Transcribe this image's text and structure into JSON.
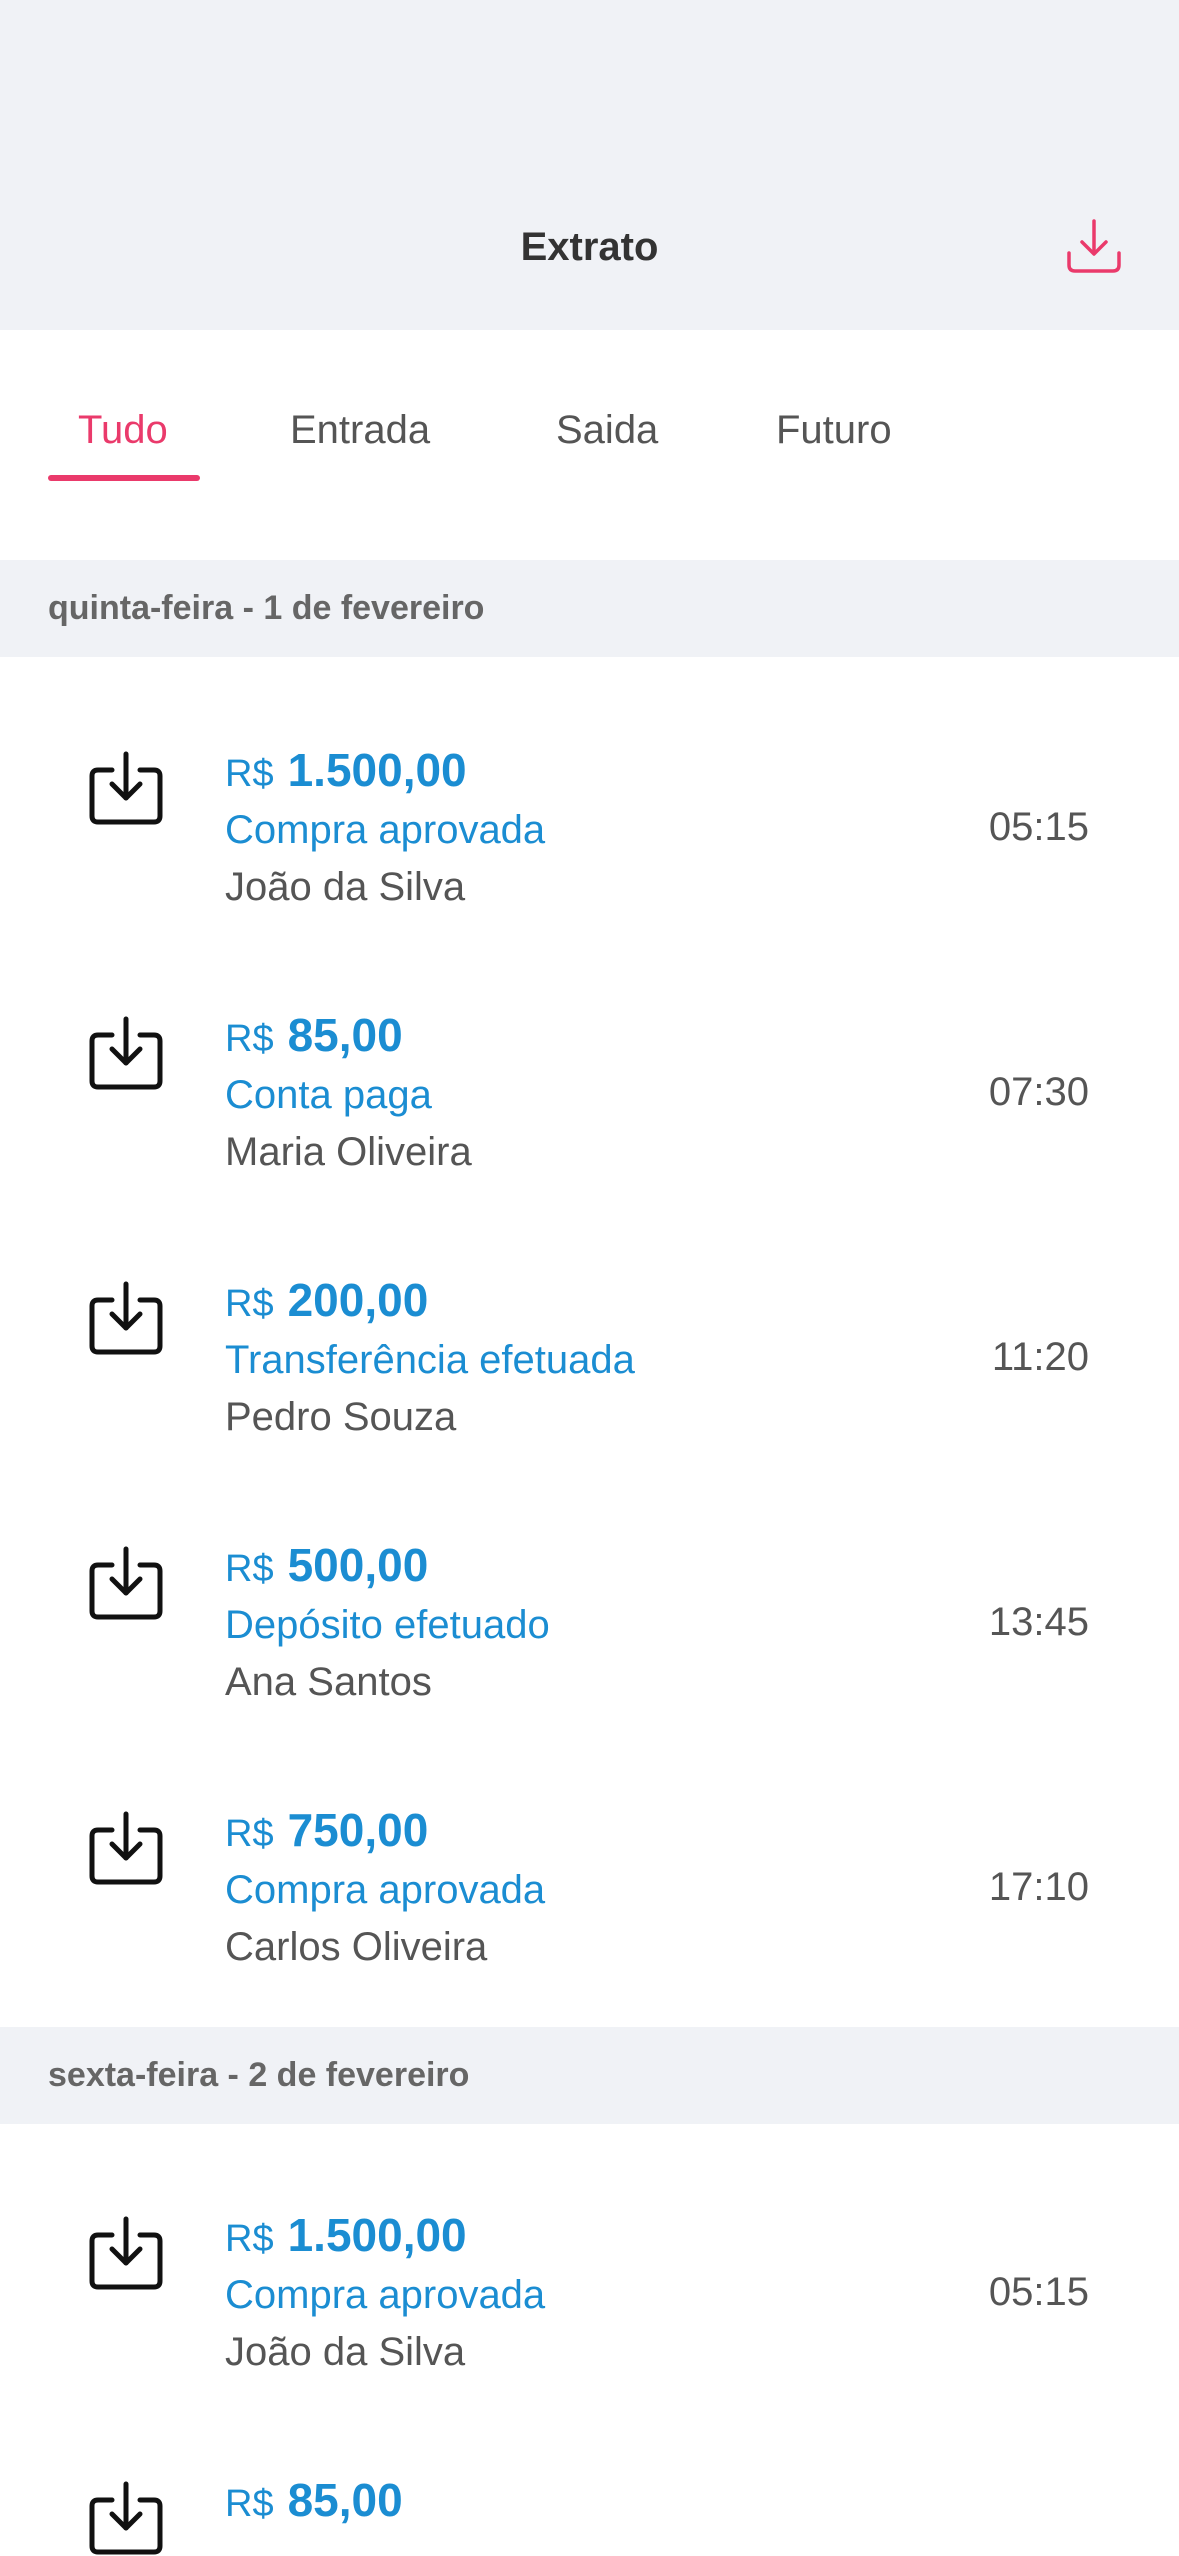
{
  "header": {
    "title": "Extrato",
    "download_icon": "download-icon",
    "accent_color": "#ea3a6b"
  },
  "tabs": [
    {
      "label": "Tudo",
      "active": true
    },
    {
      "label": "Entrada",
      "active": false
    },
    {
      "label": "Saida",
      "active": false
    },
    {
      "label": "Futuro",
      "active": false
    }
  ],
  "sections": [
    {
      "date": "quinta-feira - 1 de fevereiro",
      "transactions": [
        {
          "currency": "R$",
          "amount": "1.500,00",
          "description": "Compra aprovada",
          "name": "João da Silva",
          "time": "05:15",
          "icon": "download-tray-icon"
        },
        {
          "currency": "R$",
          "amount": "85,00",
          "description": "Conta paga",
          "name": "Maria Oliveira",
          "time": "07:30",
          "icon": "download-tray-icon"
        },
        {
          "currency": "R$",
          "amount": "200,00",
          "description": "Transferência efetuada",
          "name": "Pedro Souza",
          "time": "11:20",
          "icon": "download-tray-icon"
        },
        {
          "currency": "R$",
          "amount": "500,00",
          "description": "Depósito efetuado",
          "name": "Ana Santos",
          "time": "13:45",
          "icon": "download-tray-icon"
        },
        {
          "currency": "R$",
          "amount": "750,00",
          "description": "Compra aprovada",
          "name": "Carlos Oliveira",
          "time": "17:10",
          "icon": "download-tray-icon"
        }
      ]
    },
    {
      "date": "sexta-feira - 2 de fevereiro",
      "transactions": [
        {
          "currency": "R$",
          "amount": "1.500,00",
          "description": "Compra aprovada",
          "name": "João da Silva",
          "time": "05:15",
          "icon": "download-tray-icon"
        },
        {
          "currency": "R$",
          "amount": "85,00",
          "description": "",
          "name": "",
          "time": "",
          "icon": "download-tray-icon"
        }
      ]
    }
  ],
  "colors": {
    "accent": "#ea3a6b",
    "amount_blue": "#1b8dd2",
    "header_bg": "#f0f2f6",
    "text_gray": "#555555"
  }
}
